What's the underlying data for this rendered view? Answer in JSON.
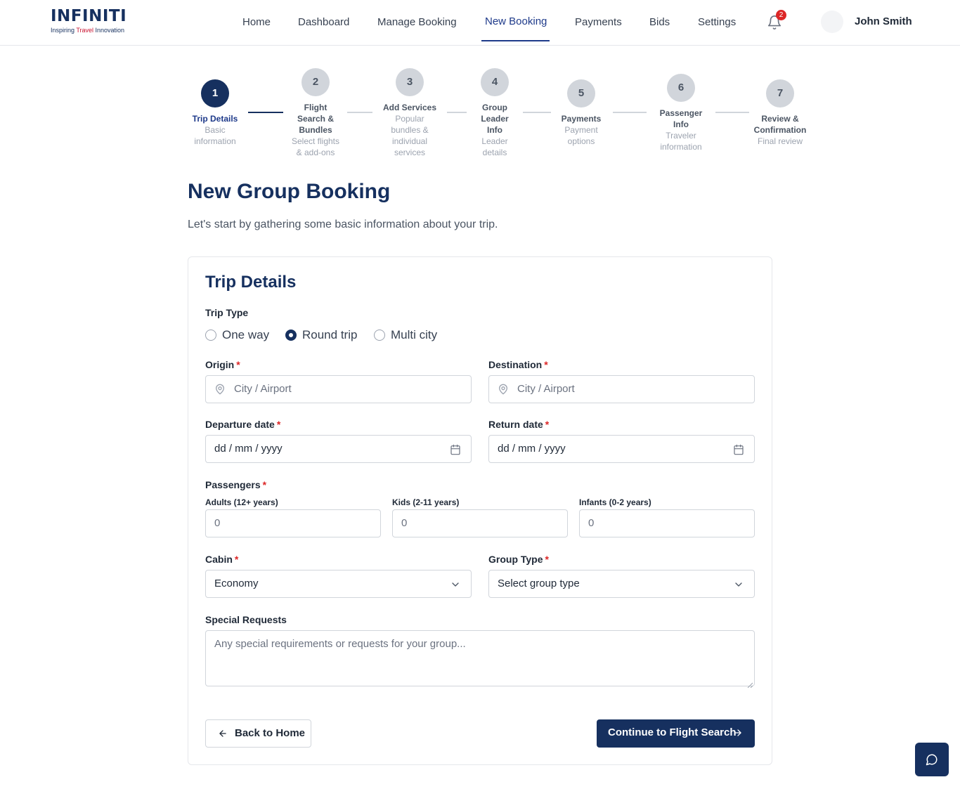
{
  "brand": {
    "logo_main": "INFINITI",
    "logo_tag_prefix": "Inspiring ",
    "logo_tag_accent": "Travel",
    "logo_tag_suffix": " Innovation"
  },
  "nav": {
    "items": [
      "Home",
      "Dashboard",
      "Manage Booking",
      "New Booking",
      "Payments",
      "Bids",
      "Settings"
    ],
    "active": "New Booking",
    "notification_count": "2",
    "user_name": "John Smith"
  },
  "stepper": [
    {
      "num": "1",
      "title_lines": [
        "Trip Details"
      ],
      "sub_lines": [
        "Basic",
        "information"
      ],
      "state": "active"
    },
    {
      "num": "2",
      "title_lines": [
        "Flight",
        "Search &",
        "Bundles"
      ],
      "sub_lines": [
        "Select flights",
        "& add-ons"
      ],
      "state": "pending"
    },
    {
      "num": "3",
      "title_lines": [
        "Add Services"
      ],
      "sub_lines": [
        "Popular",
        "bundles &",
        "individual",
        "services"
      ],
      "state": "pending"
    },
    {
      "num": "4",
      "title_lines": [
        "Group",
        "Leader",
        "Info"
      ],
      "sub_lines": [
        "Leader",
        "details"
      ],
      "state": "pending"
    },
    {
      "num": "5",
      "title_lines": [
        "Payments"
      ],
      "sub_lines": [
        "Payment",
        "options"
      ],
      "state": "pending"
    },
    {
      "num": "6",
      "title_lines": [
        "Passenger",
        "Info"
      ],
      "sub_lines": [
        "Traveler",
        "information"
      ],
      "state": "pending"
    },
    {
      "num": "7",
      "title_lines": [
        "Review &",
        "Confirmation"
      ],
      "sub_lines": [
        "Final review"
      ],
      "state": "pending"
    }
  ],
  "page": {
    "title": "New Group Booking",
    "subtitle": "Let's start by gathering some basic information about your trip."
  },
  "form": {
    "card_title": "Trip Details",
    "trip_type_label": "Trip Type",
    "trip_types": [
      "One way",
      "Round trip",
      "Multi city"
    ],
    "trip_type_selected": "Round trip",
    "origin_label": "Origin",
    "origin_placeholder": "City / Airport",
    "destination_label": "Destination",
    "destination_placeholder": "City / Airport",
    "departure_label": "Departure date",
    "departure_value": "dd / mm / yyyy",
    "return_label": "Return date",
    "return_value": "dd / mm / yyyy",
    "passengers_label": "Passengers",
    "adults_label": "Adults (12+ years)",
    "adults_value": "0",
    "kids_label": "Kids (2-11 years)",
    "kids_value": "0",
    "infants_label": "Infants (0-2 years)",
    "infants_value": "0",
    "cabin_label": "Cabin",
    "cabin_value": "Economy",
    "group_type_label": "Group Type",
    "group_type_value": "Select group type",
    "special_label": "Special Requests",
    "special_placeholder": "Any special requirements or requests for your group...",
    "required_mark": "*",
    "back_button": "Back to Home",
    "continue_button": "Continue to Flight Search"
  },
  "colors": {
    "primary": "#16305f",
    "required": "#dc2626",
    "badge": "#dc2626"
  }
}
